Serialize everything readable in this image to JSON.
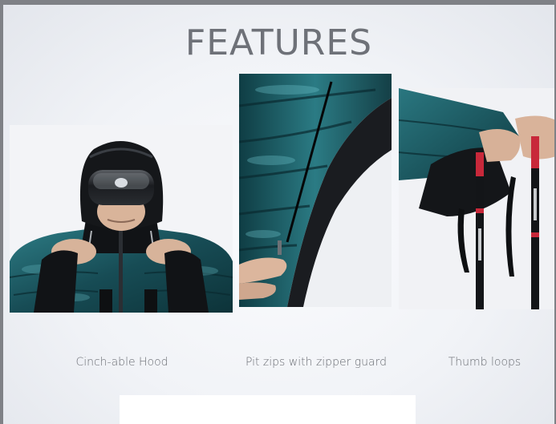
{
  "slide": {
    "title": "FEATURES",
    "features": [
      {
        "caption": "Cinch-able Hood"
      },
      {
        "caption": "Pit zips with zipper guard"
      },
      {
        "caption": "Thumb loops"
      }
    ]
  },
  "colors": {
    "background": "#f1f3f7",
    "title_text": "#6e7178",
    "jacket_teal": "#1d5a63",
    "jacket_black": "#121417",
    "pole_red": "#c8283a"
  }
}
